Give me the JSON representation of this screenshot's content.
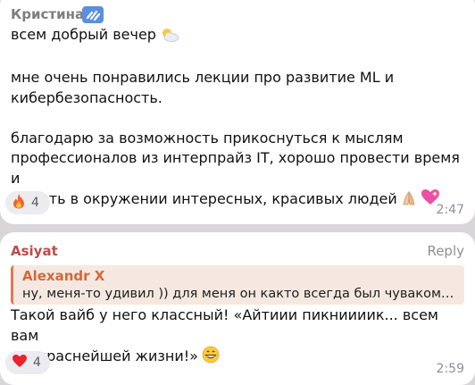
{
  "messages": [
    {
      "sender": "Кристина",
      "lines": [
        "всем добрый вечер",
        "",
        "мне очень понравились лекции про развитие ML и",
        "кибербезопасность.",
        "",
        "благодарю за возможность прикоснуться к мыслям",
        "профессионалов из интерпрайз IT, хорошо провести время и",
        "побыть в окружении интересных, красивых людей"
      ],
      "reaction": {
        "icon": "fire-emoji-icon",
        "count": "4"
      },
      "time": "2:47"
    },
    {
      "sender": "Asiyat",
      "reply_label": "Reply",
      "quote": {
        "author": "Alexandr X",
        "text": "ну, меня-то удивил )) для меня он както всегда был чуваком ..."
      },
      "lines": [
        "Такой вайб у него классный! «Айтиии пикниииик... всем вам",
        "прекраснейшей жизни!»"
      ],
      "reaction": {
        "icon": "heart-emoji-icon",
        "count": "4"
      },
      "time": "2:59"
    }
  ],
  "colors": {
    "background": "#d8d6d9",
    "bubble": "#ffffff",
    "sender1": "#7d7d85",
    "sender2": "#bf4a4a",
    "quote_accent": "#e07b4f"
  }
}
